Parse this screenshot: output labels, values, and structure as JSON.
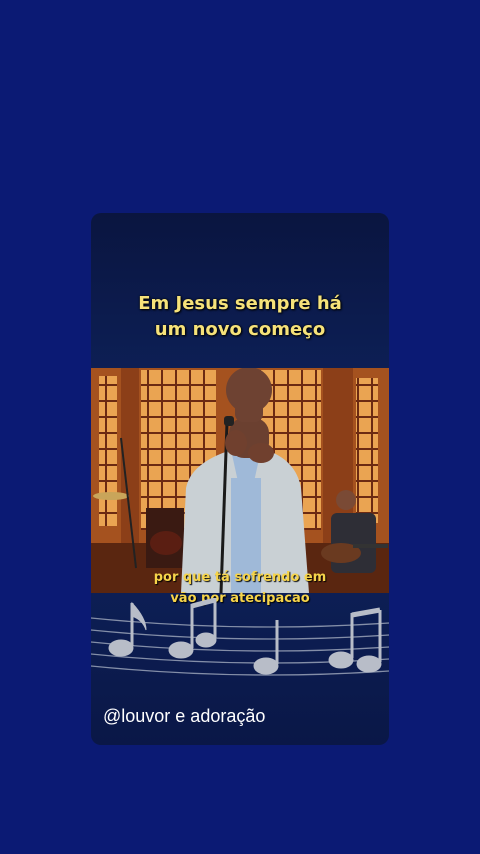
{
  "post": {
    "title": "Em Jesus sempre há\num novo começo",
    "lyrics_line1": "por que tá sofrendo em",
    "lyrics_line2": "vão por  atecipacao",
    "handle": "@louvor e adoração"
  },
  "colors": {
    "background": "#0b1a74",
    "title": "#f6e27a",
    "lyrics": "#f6d44a"
  }
}
